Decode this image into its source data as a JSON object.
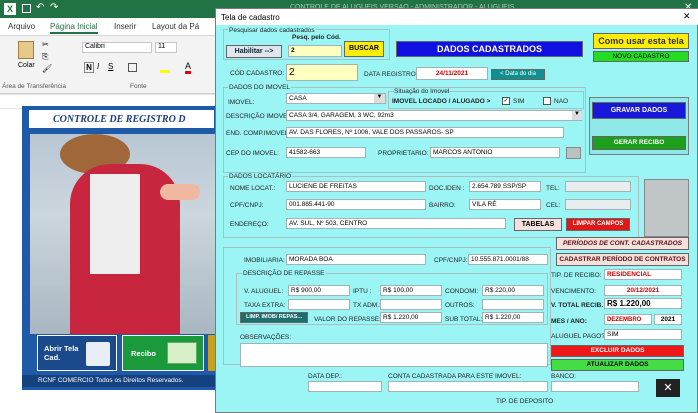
{
  "excel": {
    "title": "CONTROLE DE ALUGUEIS VERSAO - ADMINISTRADOR - ALUGUEIS...",
    "tabs": [
      "Arquivo",
      "Página Inicial",
      "Inserir",
      "Layout da Pá"
    ],
    "clipboard_label": "Área de Transferência",
    "paste_label": "Colar",
    "font_name": "Calibri",
    "font_size": "11",
    "font_group_label": "Fonte",
    "banner": "CONTROLE DE REGISTRO D",
    "tiles": {
      "open": "Abrir Tela Cad.",
      "receipt": "Recibo"
    },
    "footer": "RCNF COMERCIO Todos os Direitos Reservados."
  },
  "dialog": {
    "title": "Tela de cadastro",
    "search": {
      "legend": "Pesquisar dados cadastrados",
      "enable_btn": "Habilitar -->",
      "search_by_label": "Pesq. pelo Cód.",
      "code_value": "2",
      "search_btn": "BUSCAR"
    },
    "header_title": "DADOS CADASTRADOS",
    "howto_btn": "Como usar esta tela",
    "new_btn": "NOVO CADASTRO",
    "cod_label": "CÓD CADASTRO:",
    "cod_value": "2",
    "date_label": "DATA REGISTRO:",
    "date_value": "24/11/2021",
    "date_btn": "< Data do dia",
    "imovel": {
      "legend": "DADOS DO IMOVEL",
      "imovel_label": "IMOVEL:",
      "imovel_value": "CASA",
      "situacao_legend": "Situação do Imovel",
      "situacao_label": "IMOVEL LOCADO / ALUGADO >",
      "sim": "SIM",
      "nao": "NAO",
      "desc_label": "DESCRIÇÃO IMOVEL:",
      "desc_value": "CASA 3/4, GARAGEM, 3 WC, 92m3",
      "end_label": "END. COMP.IMOVEL:",
      "end_value": "AV. DAS FLORES, Nº 1006, VALE DOS PASSAROS- SP",
      "cep_label": "CEP DO IMOVEL:",
      "cep_value": "41582-663",
      "prop_label": "PROPRIETARIO:",
      "prop_value": "MARCOS ANTONIO"
    },
    "save_btn": "GRAVAR DADOS",
    "receipt_btn": "GERAR RECIBO",
    "locatario": {
      "legend": "DADOS LOCATÁRIO",
      "nome_label": "NOME LOCAT.:",
      "nome_value": "LUCIENE DE FREITAS",
      "doc_label": "DOC.IDEN :",
      "doc_value": "2.654.789 SSP/SP",
      "tel_label": "TEL:",
      "cpf_label": "CPF/CNPJ:",
      "cpf_value": "001.885.441-90",
      "bairro_label": "BAIRRO:",
      "bairro_value": "VILA RÉ",
      "cel_label": "CEL:",
      "end_label": "ENDEREÇO:",
      "end_value": "AV. SUL, Nº 503, CENTRO",
      "tables_btn": "TABELAS",
      "clear_btn": "LIMPAR CAMPOS"
    },
    "periodos_btn": "PERÍODOS DE CONT. CADASTRADOS",
    "cad_periodo_btn": "CADASTRAR PERÍODO DE CONTRATOS",
    "imobiliaria_label": "IMOBILIARIA:",
    "imobiliaria_value": "MORADA BOA",
    "cpf_imob_label": "CPF/CNPJ:",
    "cpf_imob_value": "10.555.871.0001/88",
    "repasse": {
      "legend": "DESCRIÇÃO DE REPASSE",
      "aluguel_label": "V. ALUGUEL:",
      "aluguel_value": "R$ 900,00",
      "iptu_label": "IPTU :",
      "iptu_value": "R$ 100,00",
      "condo_label": "CONDOMI:",
      "condo_value": "R$ 220,00",
      "taxa_extra_label": "TAXA EXTRA:",
      "taxa_adm_label": "TX ADM.:",
      "outros_label": "OUTROS:",
      "limp_btn": "LIMP. IMOB/ REPAS...",
      "valor_label": "VALOR DO REPASSE:",
      "valor_value": "R$ 1.220,00",
      "subtotal_label": "SUB TOTAL:",
      "subtotal_value": "R$ 1.220,00"
    },
    "recibo": {
      "tipo_label": "TIP. DE RECIBO:",
      "tipo_value": "RESIDENCIAL",
      "venc_label": "VENCIMENTO:",
      "venc_value": "20/12/2021",
      "total_label": "V. TOTAL RECIB.",
      "total_value": "R$ 1.220,00",
      "mes_label": "MES / ANO:",
      "mes_value": "DEZEMBRO",
      "ano_value": "2021",
      "pago_label": "ALUGUEL PAGO?",
      "pago_value": "SIM"
    },
    "delete_btn": "EXCLUIR DADOS",
    "update_btn": "ATUALIZAR DADOS",
    "obs_label": "OBSERVAÇÕES:",
    "data_dep_label": "DATA DEP.:",
    "conta_label": "CONTA CADASTRADA PARA ESTE IMOVEL:",
    "banco_label": "BANCO:",
    "tipo_dep_label": "TIP. DE DEPOSITO",
    "colors": {
      "dialog_bg": "#9cf5f5",
      "header": "#1010e0",
      "excel_green": "#217346"
    }
  }
}
